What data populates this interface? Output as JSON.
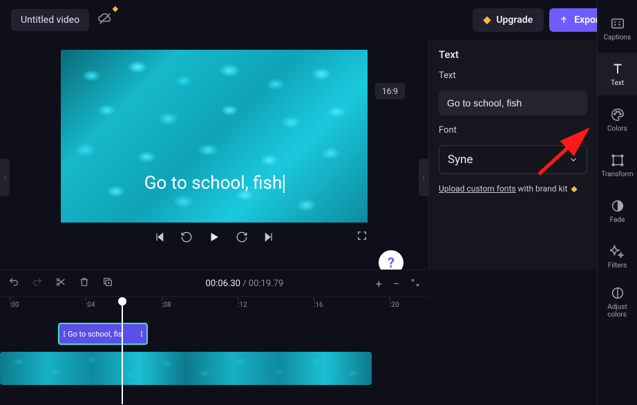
{
  "topbar": {
    "title": "Untitled video",
    "upgrade_label": "Upgrade",
    "export_label": "Export"
  },
  "preview": {
    "overlay_text": "Go to school, fish",
    "aspect_ratio": "16:9"
  },
  "transport": {},
  "right_panel": {
    "header": "Text",
    "text_label": "Text",
    "text_value": "Go to school, fish",
    "font_label": "Font",
    "font_value": "Syne",
    "upload_link": "Upload custom fonts",
    "upload_suffix": " with brand kit "
  },
  "rail": {
    "captions": "Captions",
    "text": "Text",
    "colors": "Colors",
    "transform": "Transform",
    "fade": "Fade",
    "filters": "Filters",
    "adjust1": "Adjust",
    "adjust2": "colors"
  },
  "timeline": {
    "current": "00:06",
    "current_frac": ".30",
    "sep": " / ",
    "duration": "00:19",
    "duration_frac": ".79",
    "ticks": [
      ":00",
      ":04",
      ":08",
      ":12",
      ":16",
      ":20"
    ],
    "text_clip_label": "Go to school, fis"
  }
}
